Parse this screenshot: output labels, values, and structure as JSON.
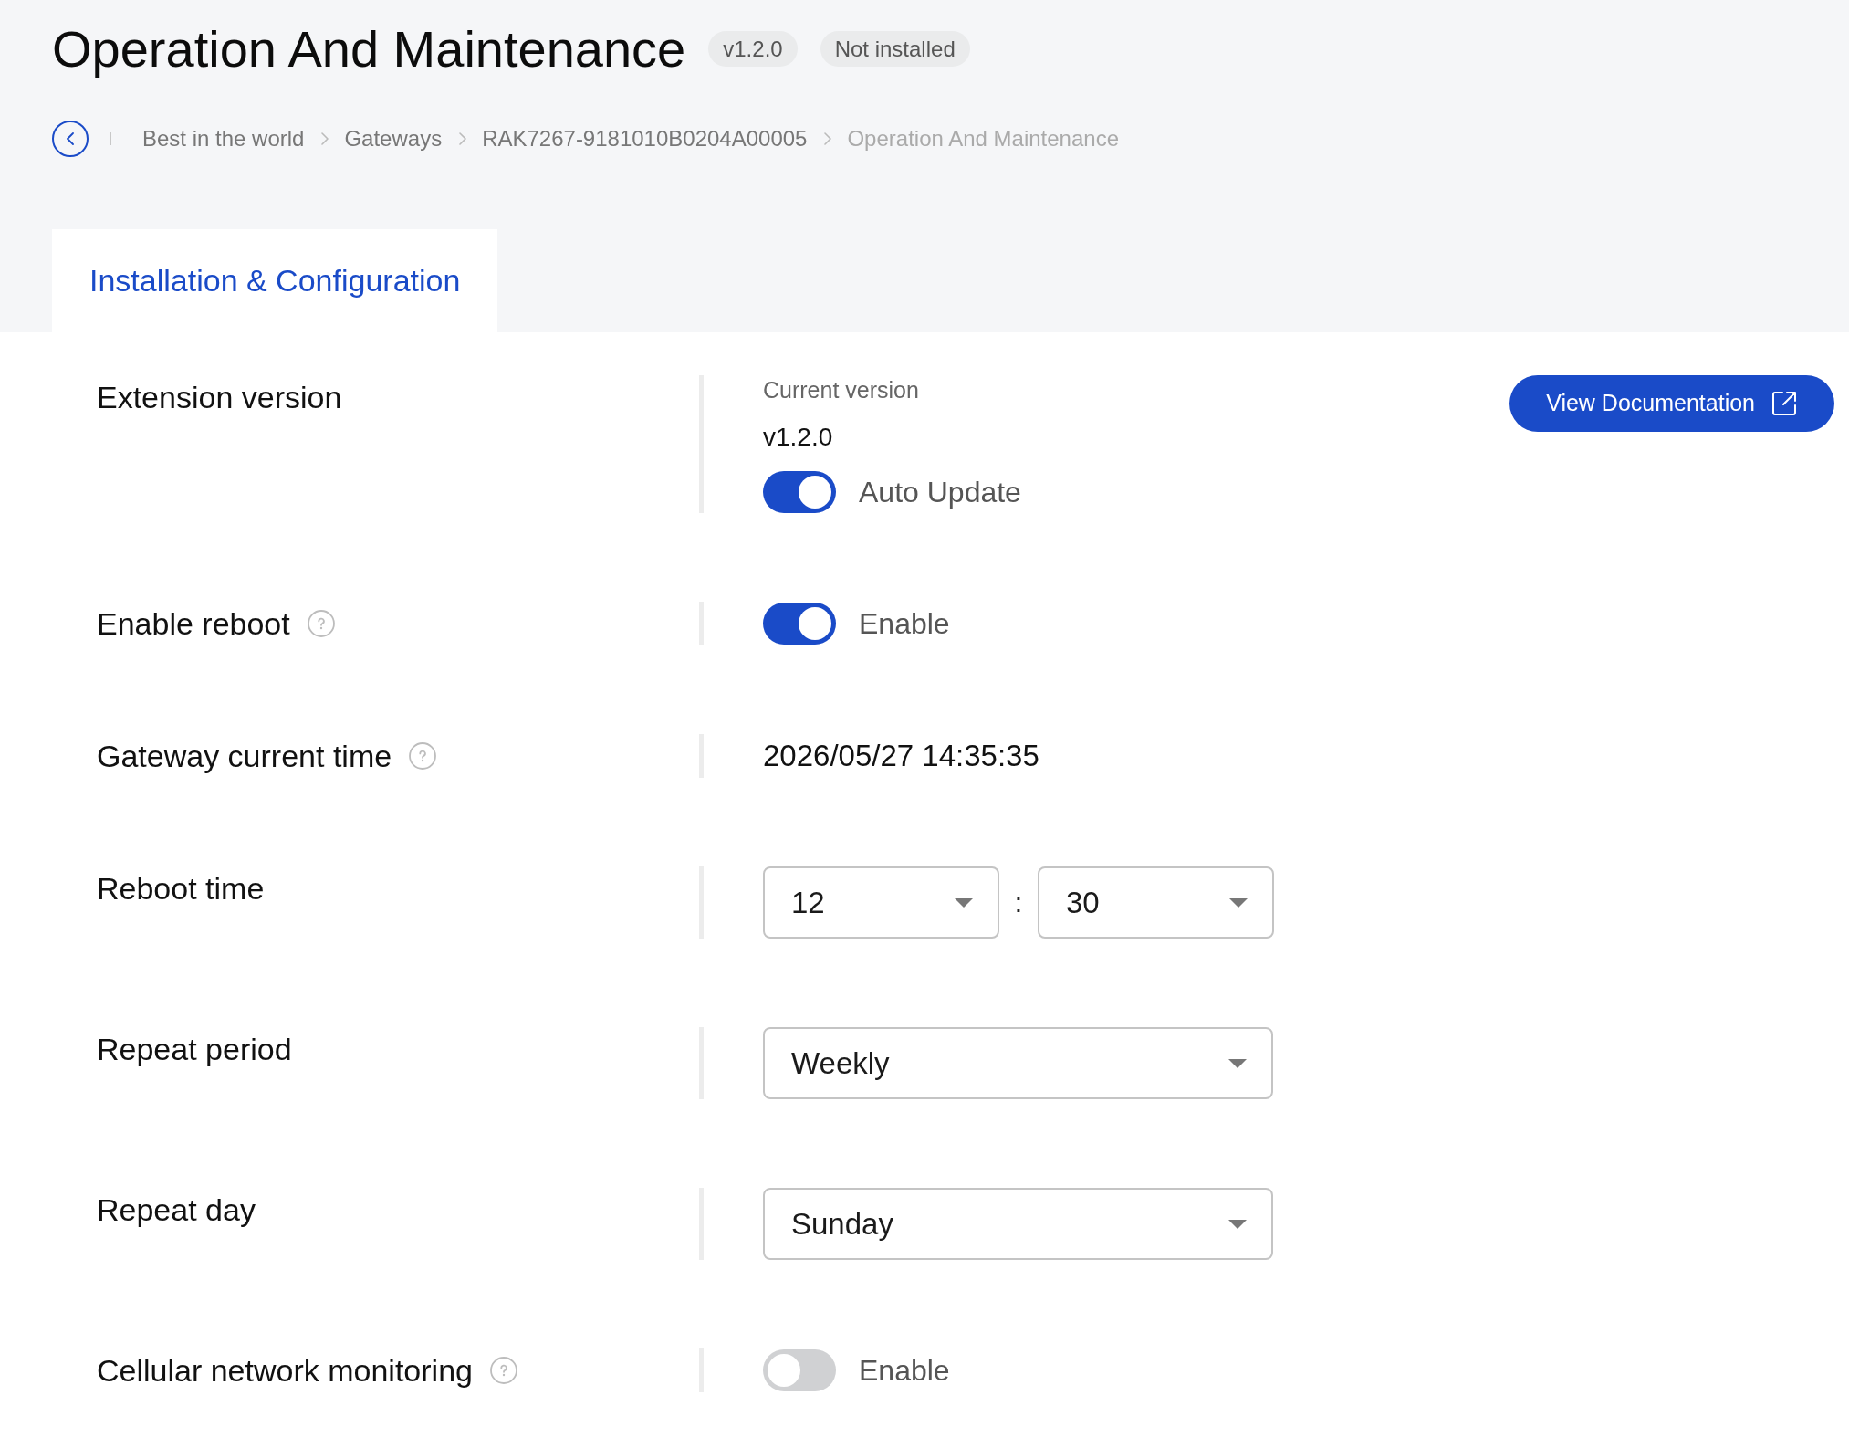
{
  "header": {
    "title": "Operation And Maintenance",
    "badges": [
      "v1.2.0",
      "Not installed"
    ]
  },
  "breadcrumb": [
    {
      "label": "Best in the world",
      "current": false
    },
    {
      "label": "Gateways",
      "current": false
    },
    {
      "label": "RAK7267-9181010B0204A00005",
      "current": false
    },
    {
      "label": "Operation And Maintenance",
      "current": true
    }
  ],
  "tabs": [
    {
      "label": "Installation & Configuration",
      "selected": true
    }
  ],
  "settings": [
    {
      "kind": "version",
      "label": "Extension version",
      "help": false,
      "caption": "Current version",
      "value": "v1.2.0",
      "toggle": {
        "label": "Auto Update",
        "checked": true
      },
      "button": "View Documentation"
    },
    {
      "kind": "toggle",
      "label": "Enable reboot",
      "help": true,
      "toggle": {
        "label": "Enable",
        "checked": true
      }
    },
    {
      "kind": "text",
      "label": "Gateway current time",
      "help": true,
      "value": "2026/05/27 14:35:35"
    },
    {
      "kind": "time",
      "label": "Reboot time",
      "help": false,
      "hour": "12",
      "separator": ":",
      "minute": "30"
    },
    {
      "kind": "select",
      "label": "Repeat period",
      "help": false,
      "value": "Weekly"
    },
    {
      "kind": "select",
      "label": "Repeat day",
      "help": false,
      "value": "Sunday"
    },
    {
      "kind": "toggle",
      "label": "Cellular network monitoring",
      "help": true,
      "toggle": {
        "label": "Enable",
        "checked": false
      }
    }
  ]
}
